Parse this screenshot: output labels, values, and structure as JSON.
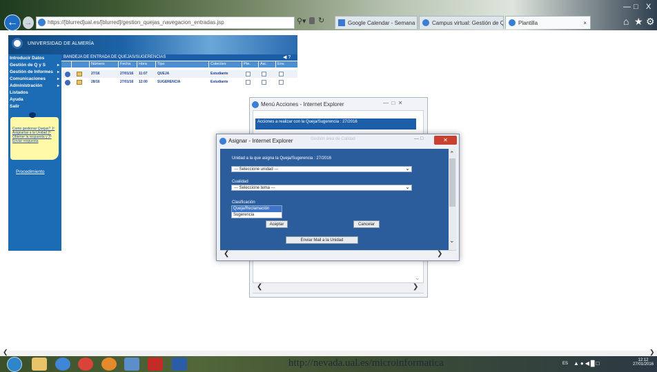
{
  "browser": {
    "url": "https://[blurred]ual.es/[blurred]/gestion_quejas_navegacion_entradas.jsp",
    "tabs": [
      {
        "label": "Google Calendar - Semana del..."
      },
      {
        "label": "Campus virtual: Gestión de Qu..."
      },
      {
        "label": "Plantilla"
      }
    ],
    "tab_close": "×",
    "window_controls": {
      "min": "—",
      "max": "□",
      "close": "X"
    }
  },
  "app": {
    "university": "UNIVERSIDAD DE ALMERÍA",
    "sidebar": {
      "items": [
        {
          "label": "Introducir Datos"
        },
        {
          "label": "Gestión de Q y S"
        },
        {
          "label": "Gestión de Informes"
        },
        {
          "label": "Comunicaciones"
        },
        {
          "label": "Administración"
        },
        {
          "label": "Listados"
        },
        {
          "label": "Ayuda"
        },
        {
          "label": "Salir"
        }
      ],
      "note_text": "Como gestionar Quejas? 1º Asignarlas a la Unidad 2º Obtener la respuesta y 3º Enviar respuesta",
      "procedure_link": "Procedimiento"
    },
    "tray": {
      "title": "BANDEJA DE ENTRADA DE QUEJAS/SUGERENCIAS",
      "columns": [
        "Número",
        "Fecha",
        "Hora",
        "Tipo",
        "Colectivo",
        "Pte.",
        "Asi.",
        "Env."
      ],
      "rows": [
        {
          "numero": "27/16",
          "fecha": "27/01/16",
          "hora": "11:07",
          "tipo": "QUEJA",
          "colectivo": "Estudiante"
        },
        {
          "numero": "28/16",
          "fecha": "27/01/16",
          "hora": "12:00",
          "tipo": "SUGERENCIA",
          "colectivo": "Estudiante"
        }
      ]
    }
  },
  "menu_popup": {
    "title": "Menú Acciones - Internet Explorer",
    "header_text": "Acciones a realizar con la Queja/Sugerencia : 27/2016"
  },
  "assign_dialog": {
    "title": "Asignar - Internet Explorer",
    "blurred_title": "Gestión área de Calidad",
    "unit_label": "Unidad a la que asigna la Queja/Sugerencia : 27/2016",
    "unit_select": "--- Seleccione unidad ---",
    "quality_label": "Cualidad",
    "theme_select": "--- Seleccione tema ---",
    "classification_label": "Clasificación",
    "classification_options": [
      {
        "label": "Queja/Reclamación",
        "selected": true
      },
      {
        "label": "Sugerencia",
        "selected": false
      }
    ],
    "accept_button": "Aceptar",
    "cancel_button": "Cancelar",
    "send_mail_button": "Enviar Mail a la Unidad"
  },
  "taskbar": {
    "watermark": "http://nevada.ual.es/microinformatica",
    "language": "ES",
    "time": "12:12",
    "date": "27/01/2016"
  }
}
